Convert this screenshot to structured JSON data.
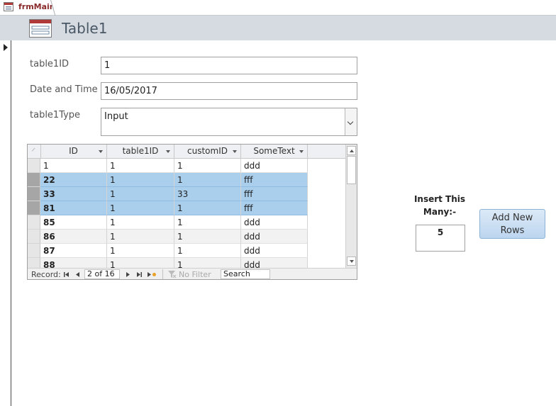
{
  "tab": {
    "title": "frmMain",
    "icon": "form-icon"
  },
  "header": {
    "title": "Table1",
    "icon": "form-icon"
  },
  "fields": {
    "table1ID": {
      "label": "table1ID",
      "value": "1"
    },
    "dateTime": {
      "label": "Date and Time",
      "value": "16/05/2017"
    },
    "table1Type": {
      "label": "table1Type",
      "value": "Input"
    }
  },
  "subform": {
    "columns": [
      "ID",
      "table1ID",
      "customID",
      "SomeText"
    ],
    "rows": [
      {
        "id": "1",
        "table1ID": "1",
        "customID": "1",
        "someText": "ddd"
      },
      {
        "id": "22",
        "table1ID": "1",
        "customID": "1",
        "someText": "fff"
      },
      {
        "id": "33",
        "table1ID": "1",
        "customID": "33",
        "someText": "fff"
      },
      {
        "id": "81",
        "table1ID": "1",
        "customID": "1",
        "someText": "fff"
      },
      {
        "id": "85",
        "table1ID": "1",
        "customID": "1",
        "someText": "ddd"
      },
      {
        "id": "86",
        "table1ID": "1",
        "customID": "1",
        "someText": "ddd"
      },
      {
        "id": "87",
        "table1ID": "1",
        "customID": "1",
        "someText": "ddd"
      },
      {
        "id": "88",
        "table1ID": "1",
        "customID": "1",
        "someText": "ddd"
      }
    ],
    "selected_rows": [
      1,
      2,
      3
    ],
    "nav": {
      "record_label": "Record:",
      "position": "2 of 16",
      "filter": "No Filter",
      "search": "Search"
    }
  },
  "insert": {
    "label_line1": "Insert This",
    "label_line2": "Many:-",
    "value": "5"
  },
  "add_button": {
    "line1": "Add New",
    "line2": "Rows"
  }
}
